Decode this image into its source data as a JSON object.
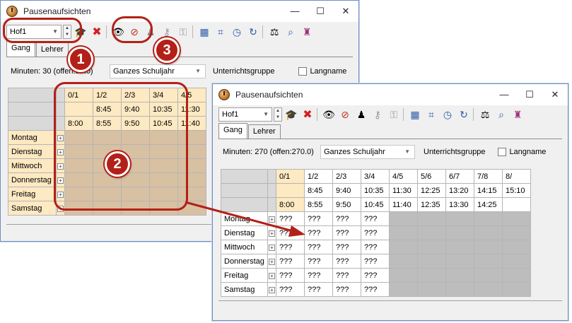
{
  "colors": {
    "accent": "#b32018",
    "header_cell": "#fde9c2",
    "day_cell": "#fde9c2",
    "unavailable_cell": "#bdbdbd",
    "highlight_cell": "#d8c0a2",
    "title_border": "#6d8fbf"
  },
  "window": {
    "title": "Pausenaufsichten",
    "controls": {
      "minimize": "—",
      "maximize": "☐",
      "close": "✕"
    }
  },
  "toolbar": {
    "hof_value": "Hof1",
    "icons": [
      "graduation-cap-icon",
      "delete-icon",
      "eye-icon",
      "eye-crossed-icon",
      "person-icon",
      "person-key-icon",
      "key-icon",
      "calculator-icon",
      "crop-icon",
      "clock-icon",
      "refresh-icon",
      "scales-icon",
      "search-icon",
      "people-icon"
    ]
  },
  "tabs": [
    "Gang",
    "Lehrer"
  ],
  "options": {
    "minutes_label": "Minuten: 270 (offen:270.0)",
    "minutes_label_back": "Minuten: 30 (offen:30.0)",
    "period_value": "Ganzes Schuljahr",
    "group_label": "Unterrichtsgruppe",
    "longname_label": "Langname"
  },
  "grid": {
    "periods": [
      "0/1",
      "1/2",
      "2/3",
      "3/4",
      "4/5",
      "5/6",
      "6/7",
      "7/8",
      "8/"
    ],
    "start_times": [
      "",
      "8:45",
      "9:40",
      "10:35",
      "11:30",
      "12:25",
      "13:20",
      "14:15",
      "15:10"
    ],
    "end_times": [
      "8:00",
      "8:55",
      "9:50",
      "10:45",
      "11:40",
      "12:35",
      "13:30",
      "14:25",
      ""
    ],
    "days": [
      "Montag",
      "Dienstag",
      "Mittwoch",
      "Donnerstag",
      "Freitag",
      "Samstag"
    ],
    "slot_text": "???"
  },
  "callouts": [
    "1",
    "2",
    "3"
  ]
}
